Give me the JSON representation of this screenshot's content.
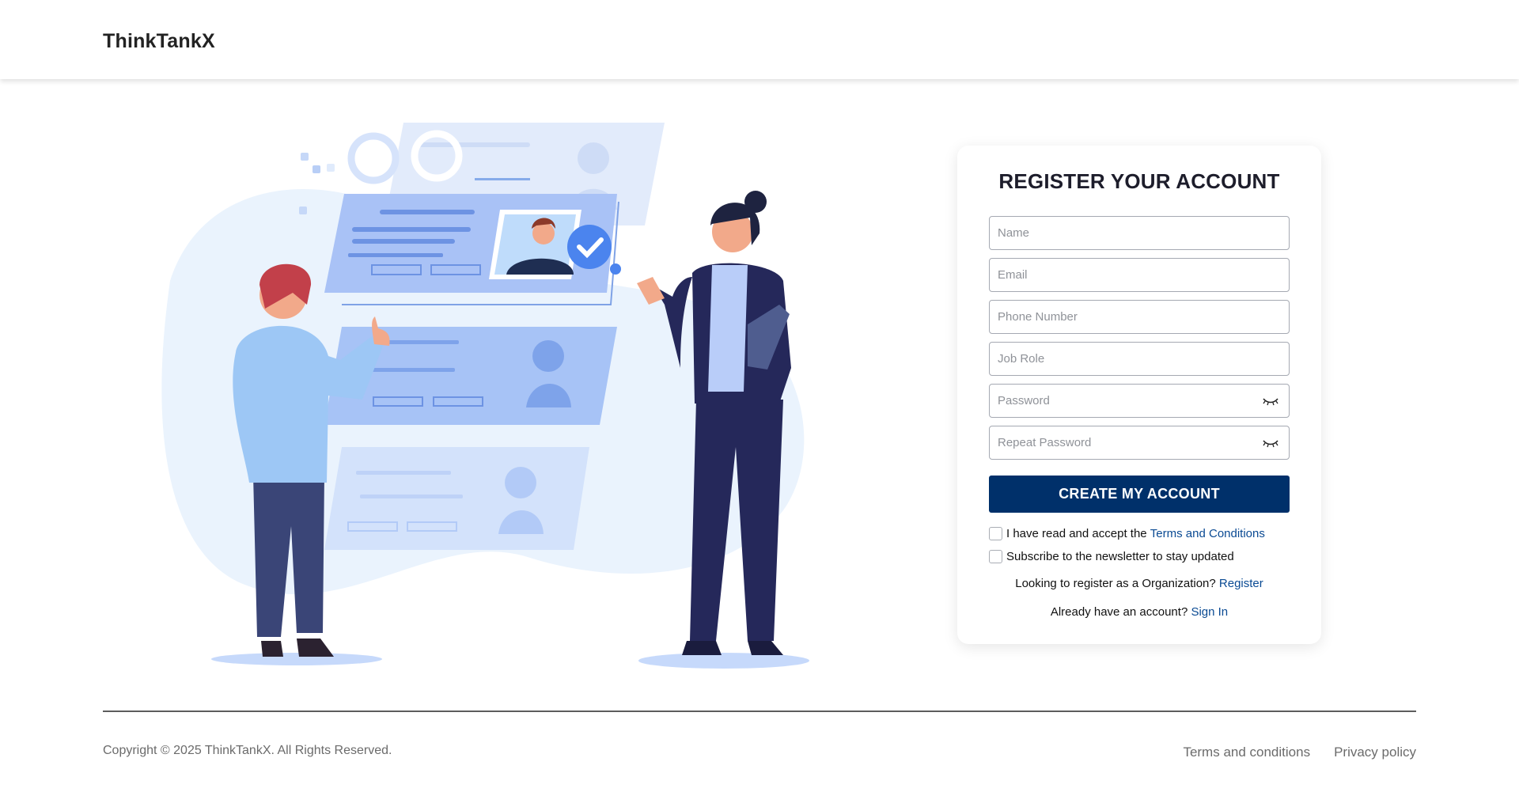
{
  "header": {
    "brand": "ThinkTankX"
  },
  "register": {
    "title": "REGISTER YOUR ACCOUNT",
    "fields": {
      "name": {
        "placeholder": "Name",
        "value": ""
      },
      "email": {
        "placeholder": "Email",
        "value": ""
      },
      "phone": {
        "placeholder": "Phone Number",
        "value": ""
      },
      "job_role": {
        "placeholder": "Job Role",
        "value": ""
      },
      "password": {
        "placeholder": "Password",
        "value": "",
        "icon": "eye-closed-icon"
      },
      "repeat_password": {
        "placeholder": "Repeat Password",
        "value": "",
        "icon": "eye-closed-icon"
      }
    },
    "submit_label": "CREATE MY ACCOUNT",
    "terms": {
      "text": "I have read and accept the ",
      "link": "Terms and Conditions",
      "checked": false
    },
    "newsletter": {
      "text": "Subscribe to the newsletter to stay updated",
      "checked": false
    },
    "organization": {
      "text": "Looking to register as a Organization? ",
      "link": "Register"
    },
    "signin": {
      "text": "Already have an account? ",
      "link": "Sign In"
    }
  },
  "footer": {
    "copyright": "Copyright © 2025 ThinkTankX. All Rights Reserved.",
    "links": [
      "Terms and conditions",
      "Privacy policy"
    ]
  },
  "colors": {
    "primary_button": "#00306a",
    "link": "#0a4a93",
    "illustration_light_blue": "#e6f1fd",
    "illustration_blue": "#9ebcf7",
    "illustration_navy": "#25285a"
  }
}
